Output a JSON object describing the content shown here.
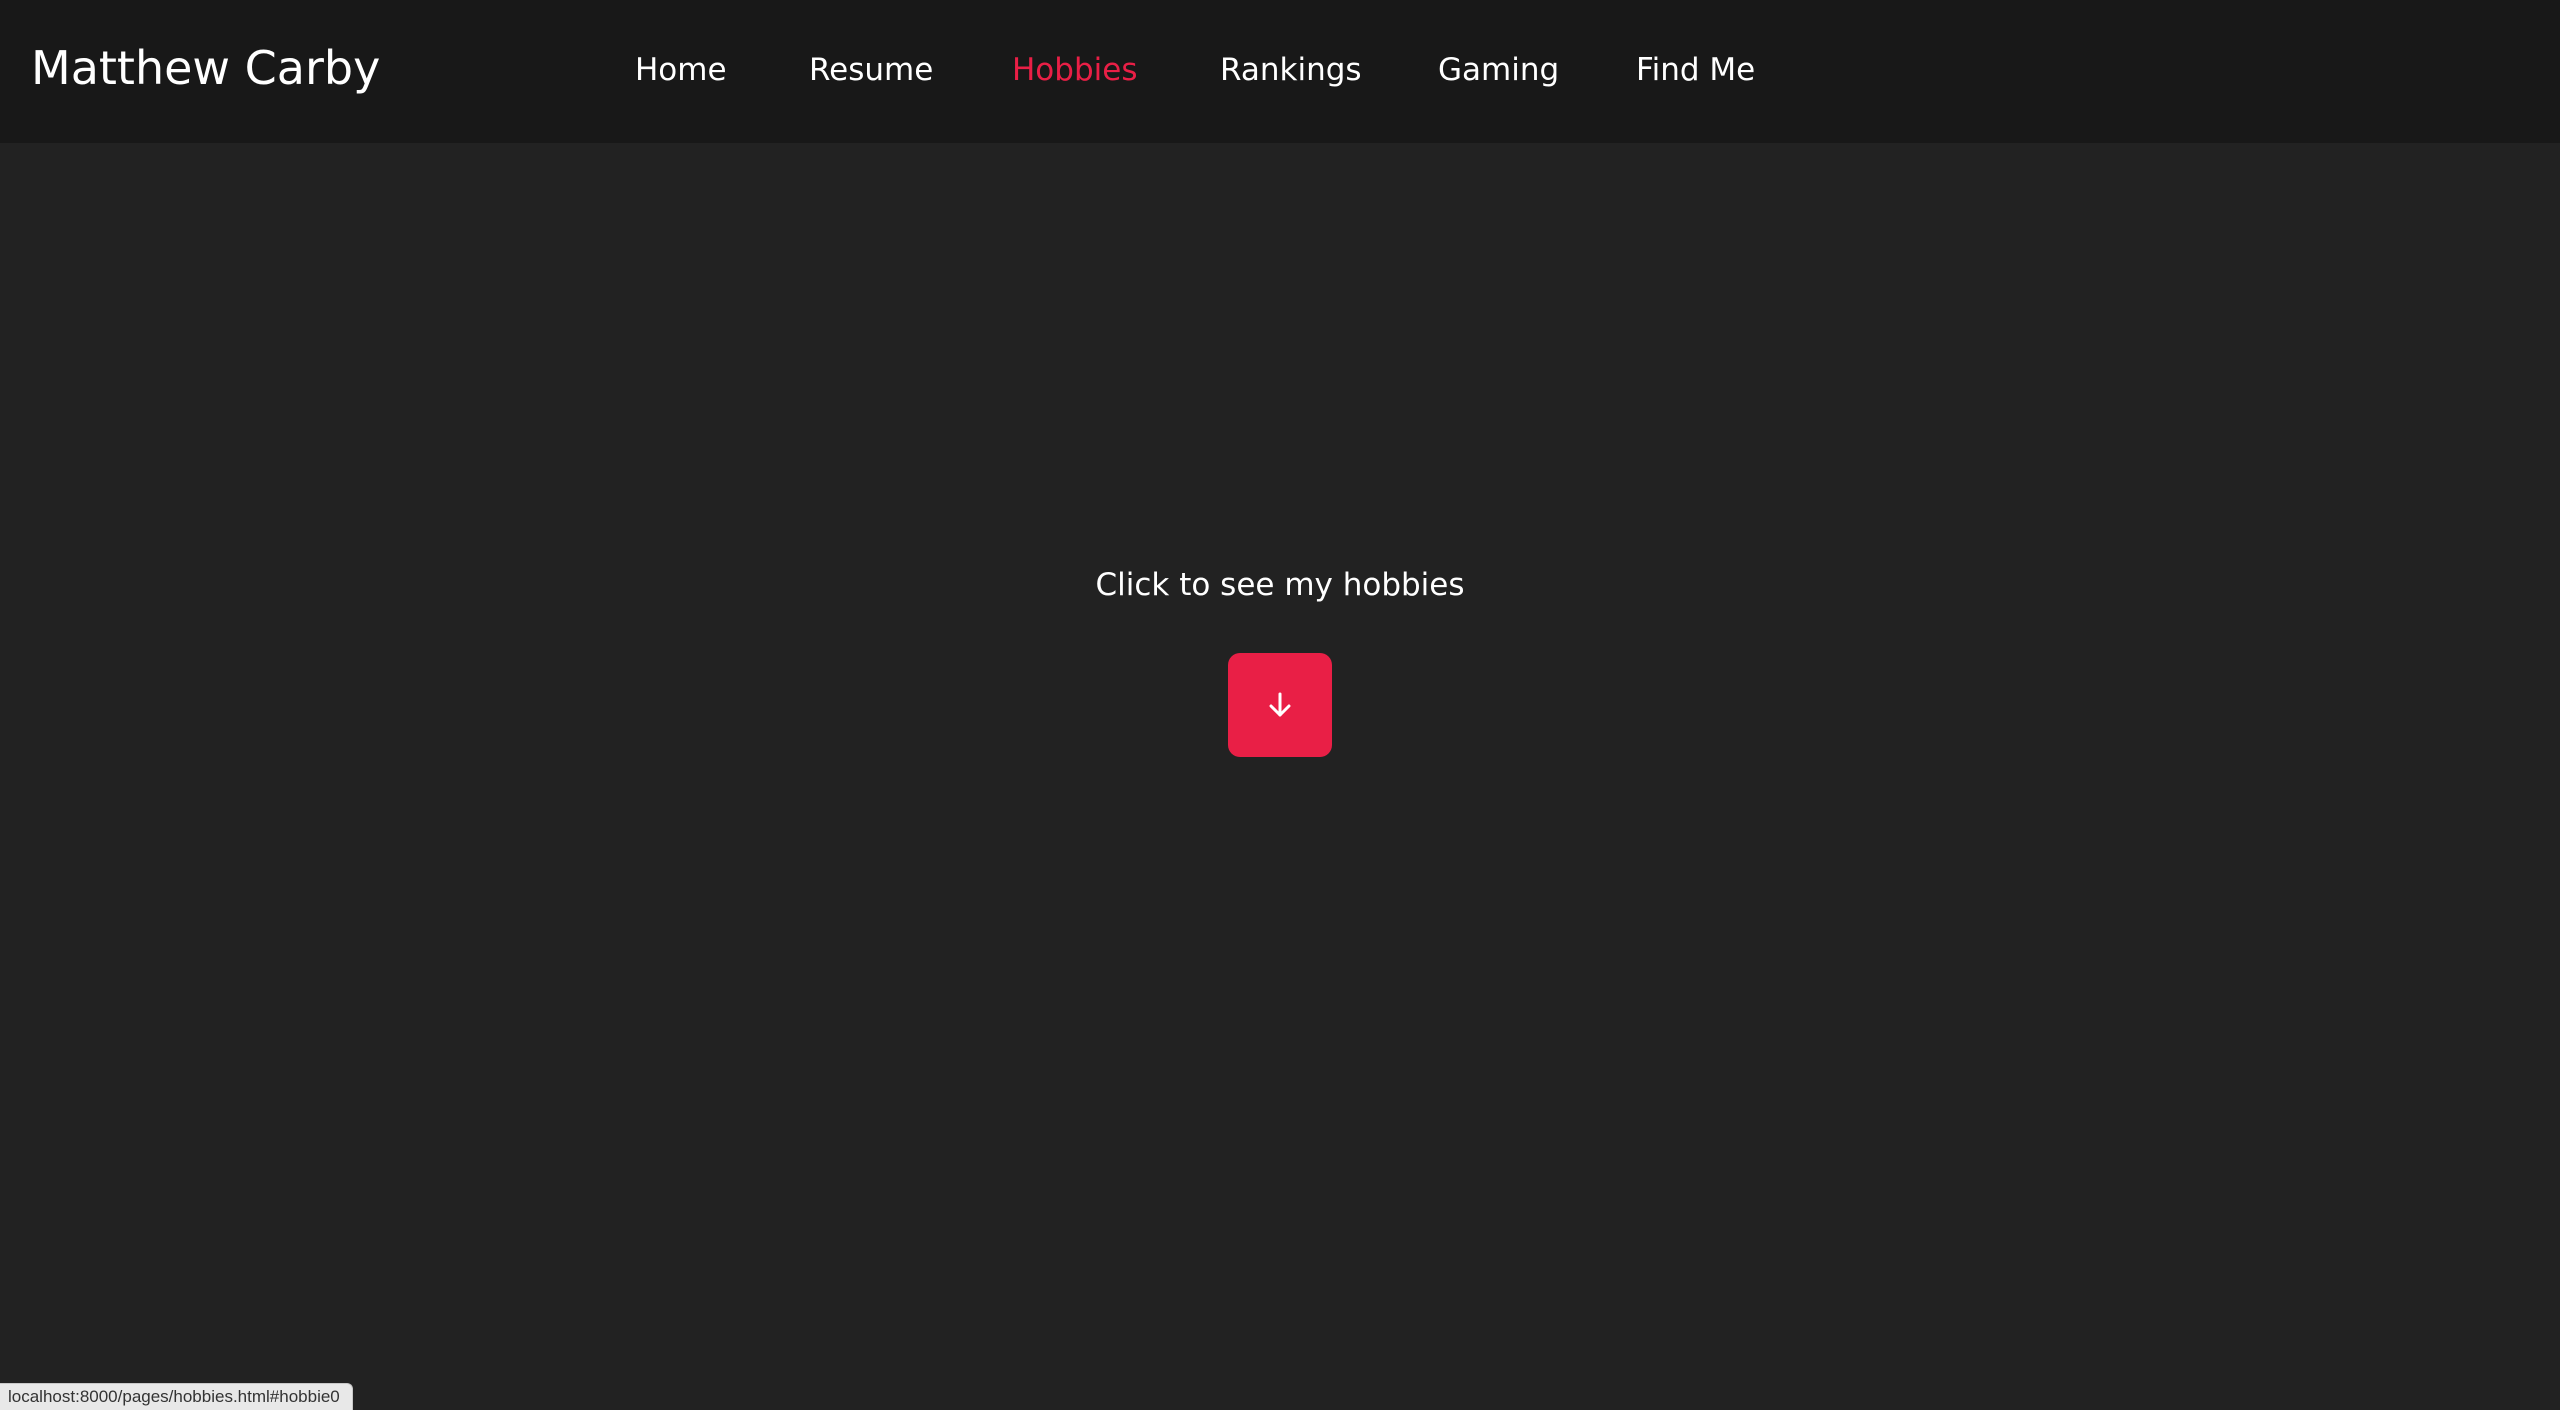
{
  "header": {
    "site_title": "Matthew Carby",
    "nav": [
      {
        "label": "Home",
        "active": false
      },
      {
        "label": "Resume",
        "active": false
      },
      {
        "label": "Hobbies",
        "active": true
      },
      {
        "label": "Rankings",
        "active": false
      },
      {
        "label": "Gaming",
        "active": false
      },
      {
        "label": "Find Me",
        "active": false
      }
    ]
  },
  "main": {
    "cta_text": "Click to see my hobbies",
    "button_icon": "arrow-down-icon"
  },
  "status_bar": {
    "url": "localhost:8000/pages/hobbies.html#hobbie0"
  },
  "colors": {
    "background": "#222222",
    "header_background": "#181818",
    "accent": "#e91f46",
    "text": "#ffffff"
  }
}
